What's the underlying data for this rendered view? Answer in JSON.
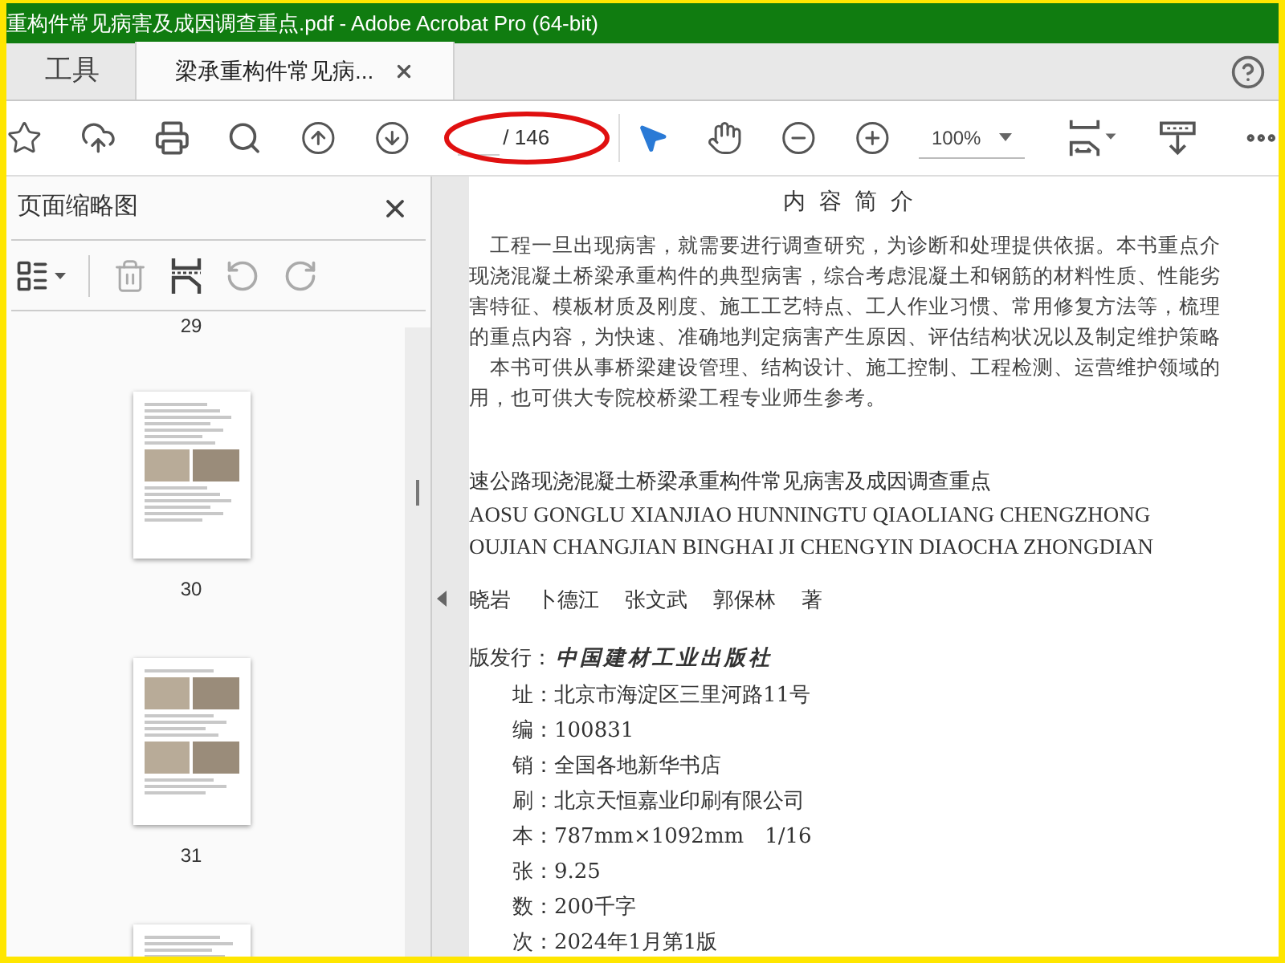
{
  "window": {
    "title": "重构件常见病害及成因调查重点.pdf - Adobe Acrobat Pro (64-bit)"
  },
  "tabs": [
    {
      "label": "工具",
      "selected": false
    },
    {
      "label": "梁承重构件常见病...",
      "selected": true
    }
  ],
  "toolbar": {
    "page_total": "/ 146",
    "zoom": "100%"
  },
  "sidebar": {
    "title": "页面缩略图",
    "thumbnails": [
      {
        "label": "29",
        "kind": "cut"
      },
      {
        "label": "30",
        "kind": "photos-middle"
      },
      {
        "label": "31",
        "kind": "photos-top"
      },
      {
        "kind": "text"
      }
    ]
  },
  "document": {
    "heading": "内 容 简 介",
    "paragraph_lines": [
      {
        "text": "工程一旦出现病害，就需要进行调查研究，为诊断和处理提供依据。本书重点介",
        "indent": true
      },
      {
        "text": "现浇混凝土桥梁承重构件的典型病害，综合考虑混凝土和钢筋的材料性质、性能劣",
        "indent": false
      },
      {
        "text": "害特征、模板材质及刚度、施工工艺特点、工人作业习惯、常用修复方法等，梳理",
        "indent": false
      },
      {
        "text": "的重点内容，为快速、准确地判定病害产生原因、评估结构状况以及制定维护策略",
        "indent": false
      },
      {
        "text": "本书可供从事桥梁建设管理、结构设计、施工控制、工程检测、运营维护领域的",
        "indent": true
      },
      {
        "text": "用，也可供大专院校桥梁工程专业师生参考。",
        "indent": false
      }
    ],
    "book_title": "速公路现浇混凝土桥梁承重构件常见病害及成因调查重点",
    "pinyin_lines": [
      "AOSU GONGLU XIANJIAO HUNNINGTU QIAOLIANG CHENGZHONG",
      "OUJIAN CHANGJIAN BINGHAI JI CHENGYIN DIAOCHA ZHONGDIAN"
    ],
    "authors": [
      "晓岩",
      "卜德江",
      "张文武",
      "郭保林",
      "著"
    ],
    "publisher": {
      "label": "版发行：",
      "value": "中国建材工业出版社"
    },
    "details": [
      {
        "label": "址：",
        "value": "北京市海淀区三里河路11号"
      },
      {
        "label": "编：",
        "value": "100831"
      },
      {
        "label": "销：",
        "value": "全国各地新华书店"
      },
      {
        "label": "刷：",
        "value": "北京天恒嘉业印刷有限公司"
      },
      {
        "label": "本：",
        "value": "787mm×1092mm　1/16"
      },
      {
        "label": "张：",
        "value": "9.25"
      },
      {
        "label": "数：",
        "value": "200千字"
      },
      {
        "label": "次：",
        "value": "2024年1月第1版"
      }
    ]
  }
}
